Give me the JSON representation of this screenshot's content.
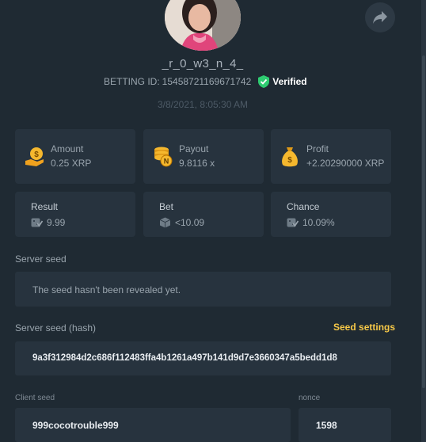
{
  "profile": {
    "username": "_r_0_w3_n_4_",
    "betting_id_label": "BETTING ID:",
    "betting_id": "15458721169671742",
    "verified_label": "Verified",
    "timestamp": "3/8/2021, 8:05:30 AM"
  },
  "stats": {
    "amount": {
      "label": "Amount",
      "value": "0.25 XRP"
    },
    "payout": {
      "label": "Payout",
      "value": "9.8116 x"
    },
    "profit": {
      "label": "Profit",
      "value": "+2.20290000 XRP"
    }
  },
  "details": {
    "result": {
      "label": "Result",
      "value": "9.99"
    },
    "bet": {
      "label": "Bet",
      "value": "<10.09"
    },
    "chance": {
      "label": "Chance",
      "value": "10.09%"
    }
  },
  "server_seed": {
    "label": "Server seed",
    "value": "The seed hasn't been revealed yet."
  },
  "server_seed_hash": {
    "label": "Server seed (hash)",
    "settings_link": "Seed settings",
    "value": "9a3f312984d2c686f112483ffa4b1261a497b141d9d7e3660347a5bedd1d8"
  },
  "client_seed": {
    "label": "Client seed",
    "value": "999cocotrouble999"
  },
  "nonce": {
    "label": "nonce",
    "value": "1598"
  },
  "colors": {
    "background": "#1f2a33",
    "card": "#27333e",
    "accent_yellow": "#f7c948",
    "verified_green": "#2ecc71"
  }
}
